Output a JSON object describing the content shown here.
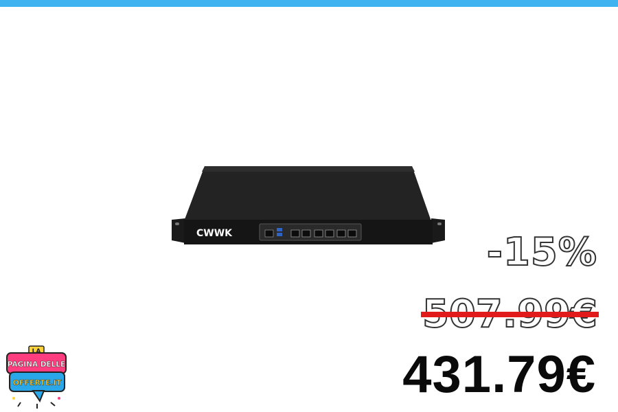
{
  "colors": {
    "top_bar": "#3fb2f0",
    "strike": "#e11b1b",
    "price": "#0a0a0a"
  },
  "product": {
    "brand_label": "CWWK"
  },
  "pricing": {
    "discount": "-15%",
    "old_price": "507.99€",
    "new_price": "431.79€"
  },
  "logo": {
    "line1": "LA",
    "line2": "PAGINA DELLE",
    "line3": "OFFERTE.IT"
  }
}
